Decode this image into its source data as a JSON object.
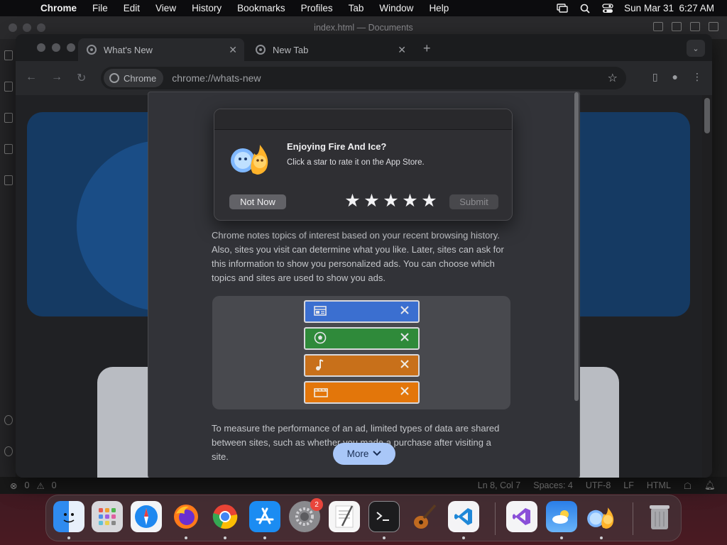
{
  "menubar": {
    "app_name": "Chrome",
    "items": [
      "File",
      "Edit",
      "View",
      "History",
      "Bookmarks",
      "Profiles",
      "Tab",
      "Window",
      "Help"
    ],
    "clock": "Sun Mar 31  6:27 AM"
  },
  "vscode": {
    "title": "index.html — Documents",
    "status_left": {
      "errors": "0",
      "warnings": "0"
    },
    "status_right": [
      "Ln 8, Col 7",
      "Spaces: 4",
      "UTF-8",
      "LF",
      "HTML"
    ]
  },
  "chrome": {
    "tabs": [
      {
        "label": "What's New",
        "active": true
      },
      {
        "label": "New Tab",
        "active": false
      }
    ],
    "omnibox": {
      "chip": "Chrome",
      "url": "chrome://whats-new"
    }
  },
  "whats_new": {
    "para1": "Chrome notes topics of interest based on your recent browsing history. Also, sites you visit can determine what you like. Later, sites can ask for this information to show you personalized ads. You can choose which topics and sites are used to show you ads.",
    "para2": "To measure the performance of an ad, limited types of data are shared between sites, such as whether you made a purchase after visiting a site.",
    "topics": [
      {
        "icon": "newspaper-icon",
        "color": "#3b6fd0",
        "glyph": "▤"
      },
      {
        "icon": "soccer-ball-icon",
        "color": "#2f8a3a",
        "glyph": "⚽"
      },
      {
        "icon": "music-note-icon",
        "color": "#d07412",
        "glyph": "♪"
      },
      {
        "icon": "film-clapper-icon",
        "color": "#e07408",
        "glyph": "🎬"
      }
    ],
    "more_label": "More"
  },
  "rating_popup": {
    "title": "Enjoying Fire And Ice?",
    "subtitle": "Click a star to rate it on the App Store.",
    "not_now": "Not Now",
    "submit": "Submit",
    "stars": [
      "★",
      "★",
      "★",
      "★",
      "★"
    ]
  },
  "dock": {
    "badge_count": "2",
    "apps": [
      "Finder",
      "Launchpad",
      "Safari",
      "Firefox",
      "Chrome",
      "App Store",
      "System Settings",
      "TextEdit",
      "Terminal",
      "GarageBand",
      "Visual Studio Code",
      "Visual Studio",
      "Weather",
      "Fire And Ice",
      "Trash"
    ]
  }
}
